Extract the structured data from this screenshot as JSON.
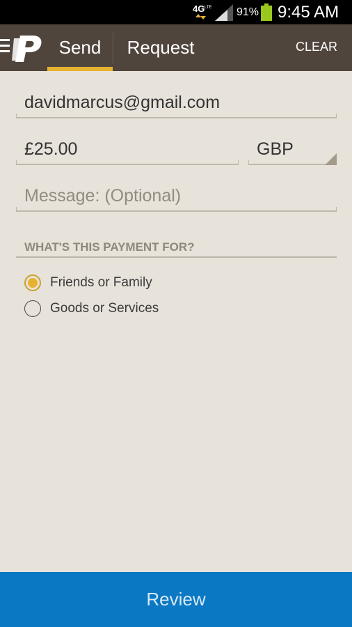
{
  "status_bar": {
    "network": "4G",
    "battery_percent": "91%",
    "time": "9:45 AM",
    "battery_color": "#9ac81f"
  },
  "app_bar": {
    "logo_icon": "paypal-logo",
    "menu_icon": "hamburger-menu-icon",
    "tabs": [
      {
        "label": "Send",
        "active": true
      },
      {
        "label": "Request",
        "active": false
      }
    ],
    "clear_label": "CLEAR",
    "background_color": "#50453d",
    "active_tab_indicator_color": "#e7b22f"
  },
  "form": {
    "email_value": "davidmarcus@gmail.com",
    "amount_value": "£25.00",
    "currency_value": "GBP",
    "message_placeholder": "Message: (Optional)"
  },
  "payment_purpose": {
    "title": "WHAT'S THIS PAYMENT FOR?",
    "options": [
      {
        "label": "Friends or Family",
        "selected": true
      },
      {
        "label": "Goods or Services",
        "selected": false
      }
    ]
  },
  "review_button": {
    "label": "Review",
    "color": "#0a78c2"
  }
}
